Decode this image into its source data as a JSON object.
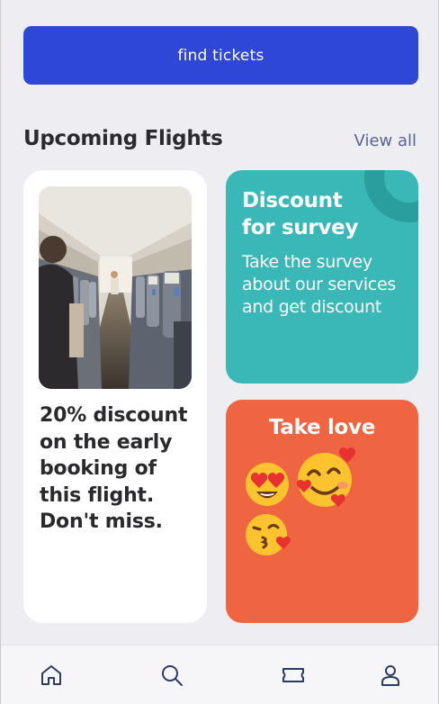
{
  "actions": {
    "find_tickets_label": "find tickets"
  },
  "section": {
    "title": "Upcoming Flights",
    "view_all_label": "View all"
  },
  "cards": {
    "promo": {
      "text": "20% discount on the early booking of this flight. Don't miss."
    },
    "survey": {
      "title": "Discount for survey",
      "body": "Take the survey about our services and get discount"
    },
    "love": {
      "title": "Take love"
    }
  },
  "nav": [
    {
      "name": "home",
      "icon": "home-icon"
    },
    {
      "name": "search",
      "icon": "search-icon"
    },
    {
      "name": "tickets",
      "icon": "ticket-icon"
    },
    {
      "name": "profile",
      "icon": "user-icon"
    }
  ],
  "colors": {
    "primary": "#2f47d6",
    "survey_card": "#3ab8b8",
    "love_card": "#ef6542",
    "background": "#eeedf2",
    "link": "#5a6494"
  }
}
